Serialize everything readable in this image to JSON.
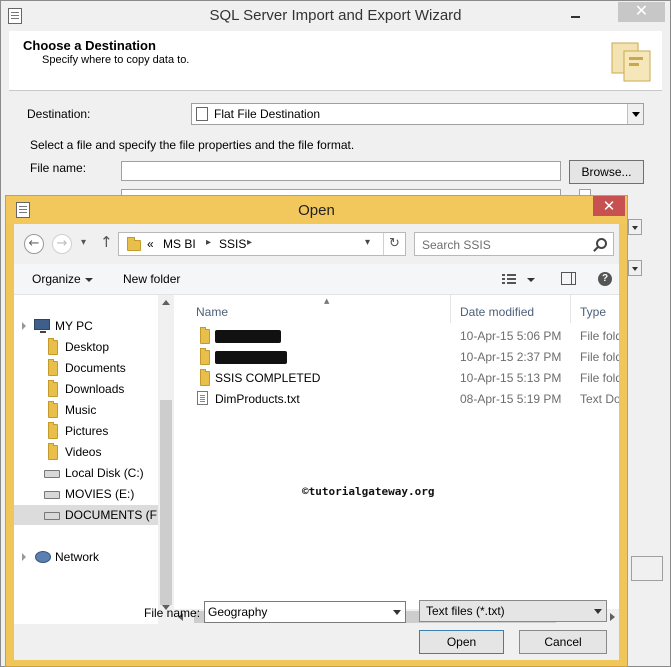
{
  "wizard": {
    "title": "SQL Server Import and Export Wizard",
    "heading": "Choose a Destination",
    "subheading": "Specify where to copy data to.",
    "destination_label": "Destination:",
    "destination_value": "Flat File Destination",
    "instructions": "Select a file and specify the file properties and the file format.",
    "file_name_label": "File name:",
    "browse_label": "Browse..."
  },
  "dialog": {
    "title": "Open",
    "breadcrumb": [
      "«",
      "MS BI",
      "SSIS"
    ],
    "search_placeholder": "Search SSIS",
    "toolbar": {
      "organize": "Organize",
      "new_folder": "New folder"
    },
    "nav": {
      "my_pc": "MY PC",
      "items": [
        {
          "label": "Desktop",
          "icon": "folder-icon"
        },
        {
          "label": "Documents",
          "icon": "folder-icon"
        },
        {
          "label": "Downloads",
          "icon": "folder-icon"
        },
        {
          "label": "Music",
          "icon": "folder-icon"
        },
        {
          "label": "Pictures",
          "icon": "folder-icon"
        },
        {
          "label": "Videos",
          "icon": "folder-icon"
        },
        {
          "label": "Local Disk (C:)",
          "icon": "drive-icon"
        },
        {
          "label": "MOVIES (E:)",
          "icon": "drive-icon"
        },
        {
          "label": "DOCUMENTS (F:",
          "icon": "drive-icon"
        }
      ],
      "network": "Network"
    },
    "columns": {
      "name": "Name",
      "date": "Date modified",
      "type": "Type"
    },
    "files": [
      {
        "name": "",
        "date": "10-Apr-15 5:06 PM",
        "type": "File folder",
        "redacted": true
      },
      {
        "name": "",
        "date": "10-Apr-15 2:37 PM",
        "type": "File folder",
        "redacted": true
      },
      {
        "name": "SSIS COMPLETED",
        "date": "10-Apr-15 5:13 PM",
        "type": "File folder",
        "redacted": false
      },
      {
        "name": "DimProducts.txt",
        "date": "08-Apr-15 5:19 PM",
        "type": "Text Document",
        "redacted": false
      }
    ],
    "watermark": "©tutorialgateway.org",
    "file_name_label": "File name:",
    "file_name_value": "Geography",
    "filter_value": "Text files (*.txt)",
    "open_label": "Open",
    "cancel_label": "Cancel"
  }
}
